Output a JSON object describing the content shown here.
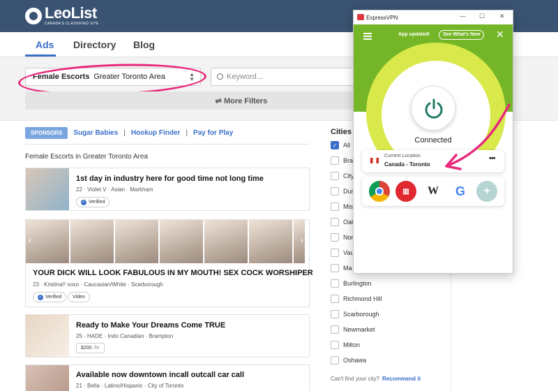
{
  "header": {
    "logo_name": "LeoList",
    "logo_tagline": "CANADA'S CLASSIFIED SITE"
  },
  "nav": {
    "tabs": [
      {
        "label": "Ads"
      },
      {
        "label": "Directory"
      },
      {
        "label": "Blog"
      }
    ]
  },
  "filters": {
    "category": "Female Escorts",
    "region": "Greater Toronto Area",
    "keyword_placeholder": "Keyword...",
    "more_filters": "More Filters"
  },
  "sponsors": {
    "badge": "SPONSORS",
    "links": [
      "Sugar Babies",
      "Hookup Finder",
      "Pay for Play"
    ],
    "separator": "|"
  },
  "breadcrumb": "Female Escorts in Greater Toronto Area",
  "listings": [
    {
      "title": "1st day in industry here for good time not long time",
      "meta": "22 · Violet V · Asian · Markham",
      "badge": "Verified"
    },
    {
      "title": "YOUR DICK WILL LOOK FABULOUS IN MY MOUTH! SEX COCK WORSHIPER",
      "meta": "23 · Kristina!! xoxo · Caucasian/White · Scarborough",
      "badge": "Verified",
      "badge2": "Video"
    },
    {
      "title": "Ready to Make Your Dreams Come TRUE",
      "meta": "25 · HADE · Indo Canadian · Brampton",
      "price": "$200",
      "price_unit": "/hr"
    },
    {
      "title": "Available now downtown incall outcall car call",
      "meta": "21 · Bella · Latino/Hispanic · City of Toronto"
    }
  ],
  "cities": {
    "title": "Cities",
    "items": [
      {
        "label": "All",
        "checked": true
      },
      {
        "label": "Bra",
        "checked": false
      },
      {
        "label": "City",
        "checked": false
      },
      {
        "label": "Dur",
        "checked": false
      },
      {
        "label": "Mis",
        "checked": false
      },
      {
        "label": "Oak",
        "checked": false
      },
      {
        "label": "Nor",
        "checked": false
      },
      {
        "label": "Vau",
        "checked": false
      },
      {
        "label": "Ma",
        "checked": false
      },
      {
        "label": "Burlington",
        "checked": false
      },
      {
        "label": "Richmond Hill",
        "checked": false
      },
      {
        "label": "Scarborough",
        "checked": false
      },
      {
        "label": "Newmarket",
        "checked": false
      },
      {
        "label": "Milton",
        "checked": false
      },
      {
        "label": "Oshawa",
        "checked": false
      }
    ],
    "cant_find": "Can't find your city?",
    "recommend": "Recommend it"
  },
  "vpn": {
    "window_title": "ExpressVPN",
    "app_updated": "App updated!",
    "whats_new": "See What's New",
    "status": "Connected",
    "current_location_label": "Current Location",
    "location": "Canada - Toronto",
    "more_icon": "•••",
    "shortcuts": [
      "chrome-icon",
      "mylifeorganized-icon",
      "wikipedia-icon",
      "google-icon",
      "add-icon"
    ],
    "wikipedia_glyph": "W",
    "google_glyph": "G",
    "add_glyph": "+",
    "colors": {
      "green": "#75b628",
      "lime": "#d9e84a",
      "power": "#1f7a64",
      "red": "#da3940"
    }
  },
  "annotation_color": "#e8287a"
}
